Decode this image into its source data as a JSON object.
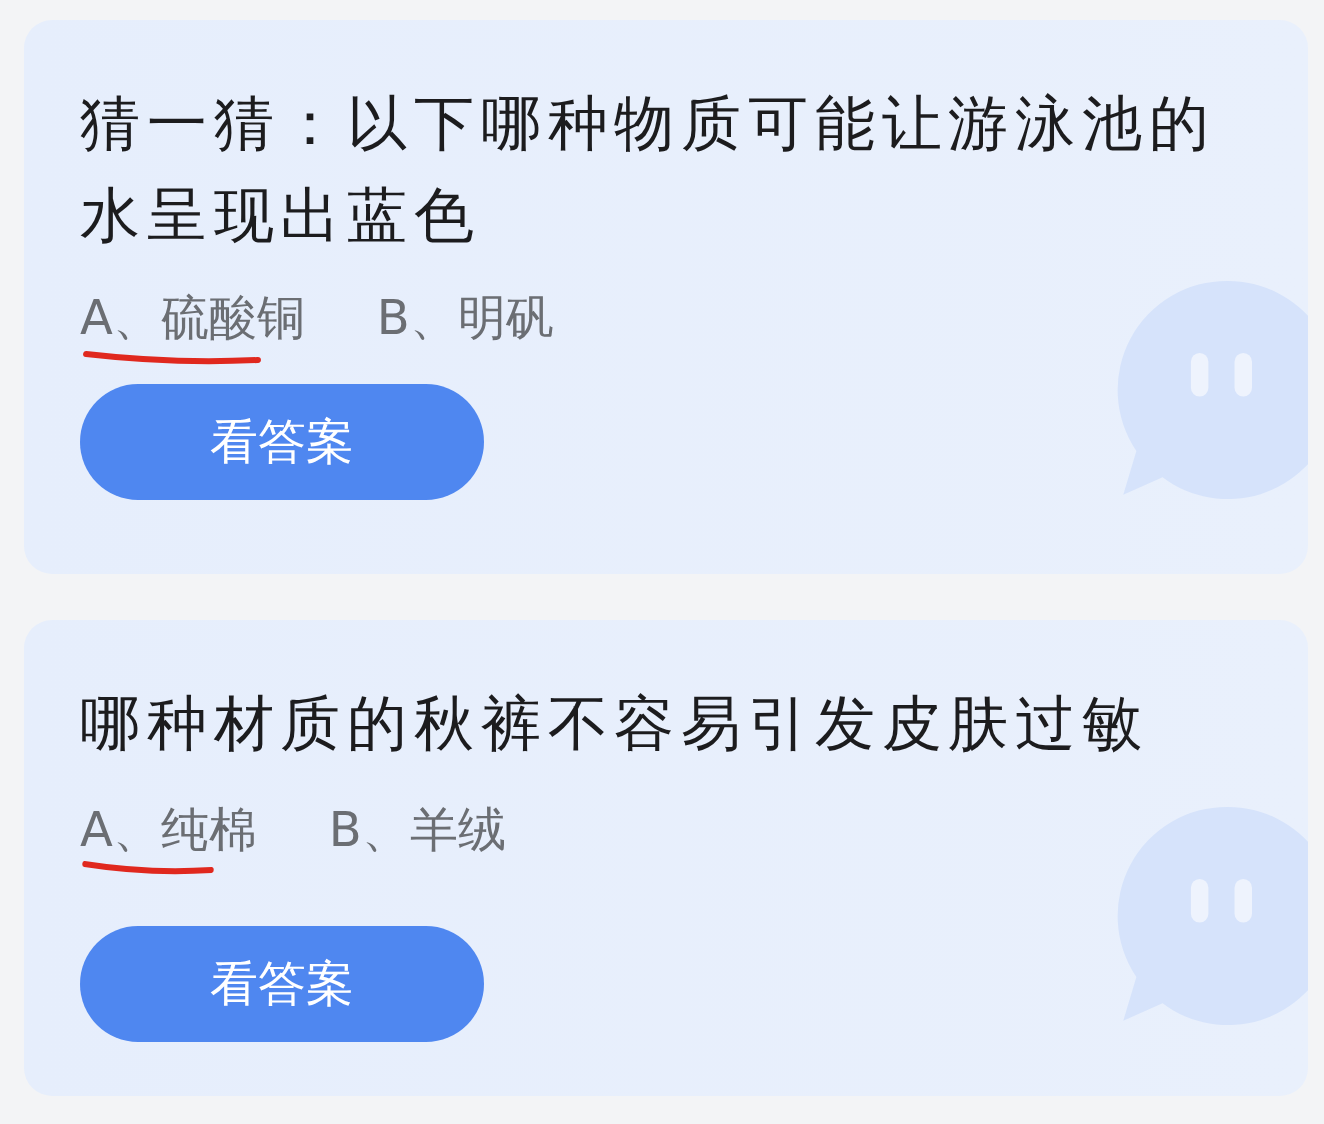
{
  "cards": [
    {
      "question": "猜一猜：以下哪种物质可能让游泳池的水呈现出蓝色",
      "options": [
        {
          "text": "A、硫酸铜",
          "underlined": true
        },
        {
          "text": "B、明矾",
          "underlined": false
        }
      ],
      "button": "看答案"
    },
    {
      "question": "哪种材质的秋裤不容易引发皮肤过敏",
      "options": [
        {
          "text": "A、纯棉",
          "underlined": true
        },
        {
          "text": "B、羊绒",
          "underlined": false
        }
      ],
      "button": "看答案"
    }
  ]
}
